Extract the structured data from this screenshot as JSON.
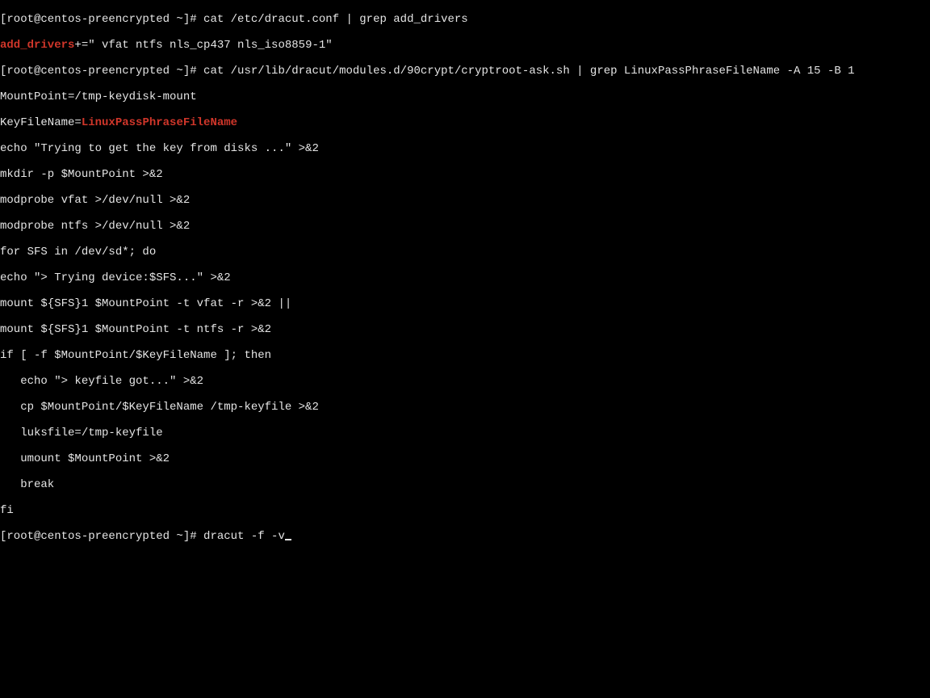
{
  "lines": {
    "l0_prompt": "[root@centos-preencrypted ~]# ",
    "l0_cmd": "cat /etc/dracut.conf | grep add_drivers",
    "l1_hl": "add_drivers",
    "l1_rest": "+=\" vfat ntfs nls_cp437 nls_iso8859-1\"",
    "l2_prompt": "[root@centos-preencrypted ~]# ",
    "l2_cmd": "cat /usr/lib/dracut/modules.d/90crypt/cryptroot-ask.sh | grep LinuxPassPhraseFileName -A 15 -B 1",
    "l3": "MountPoint=/tmp-keydisk-mount",
    "l4_key": "KeyFileName=",
    "l4_hl": "LinuxPassPhraseFileName",
    "l5": "echo \"Trying to get the key from disks ...\" >&2",
    "l6": "mkdir -p $MountPoint >&2",
    "l7": "modprobe vfat >/dev/null >&2",
    "l8": "modprobe ntfs >/dev/null >&2",
    "l9": "for SFS in /dev/sd*; do",
    "l10": "echo \"> Trying device:$SFS...\" >&2",
    "l11": "mount ${SFS}1 $MountPoint -t vfat -r >&2 ||",
    "l12": "mount ${SFS}1 $MountPoint -t ntfs -r >&2",
    "l13": "if [ -f $MountPoint/$KeyFileName ]; then",
    "l14": "   echo \"> keyfile got...\" >&2",
    "l15": "   cp $MountPoint/$KeyFileName /tmp-keyfile >&2",
    "l16": "   luksfile=/tmp-keyfile",
    "l17": "   umount $MountPoint >&2",
    "l18": "   break",
    "l19": "fi",
    "l20_prompt": "[root@centos-preencrypted ~]# ",
    "l20_cmd": "dracut -f -v"
  }
}
